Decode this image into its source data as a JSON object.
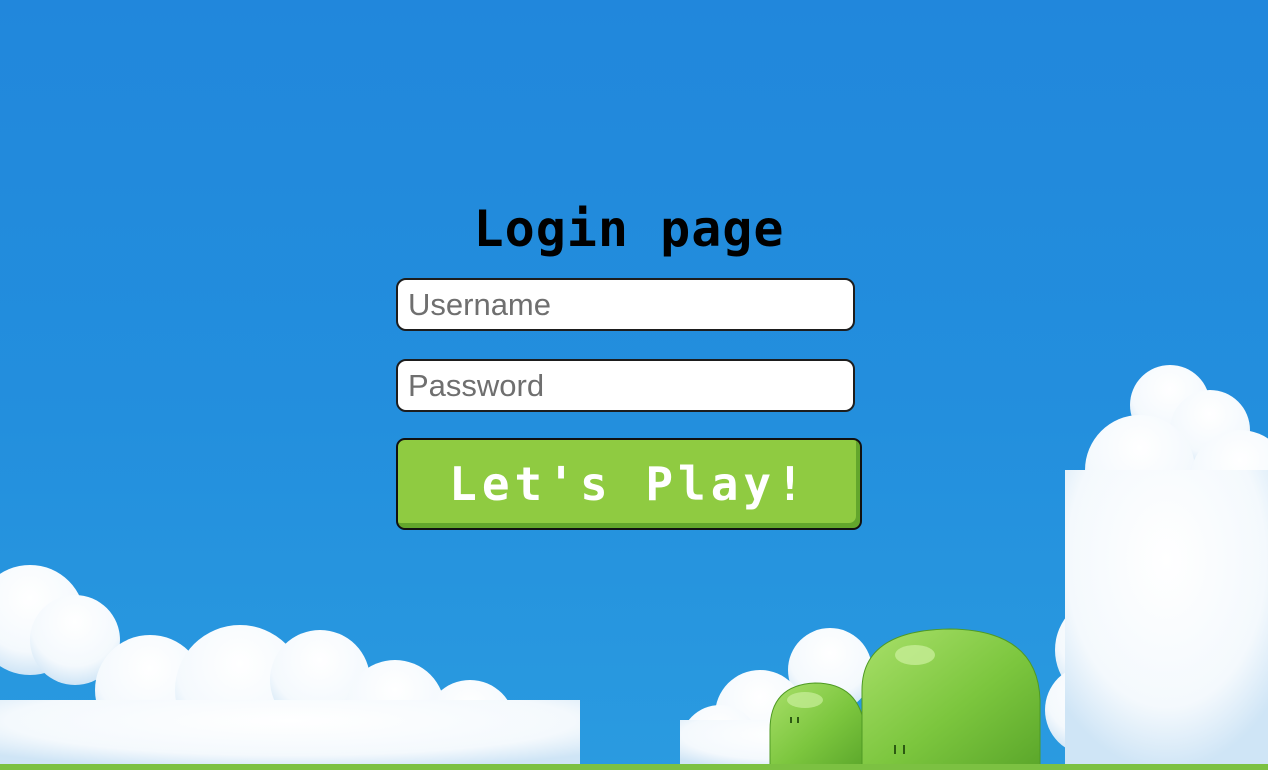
{
  "page": {
    "title": "Login page"
  },
  "form": {
    "username_placeholder": "Username",
    "username_value": "",
    "password_placeholder": "Password",
    "password_value": "",
    "submit_label": "Let's Play!"
  },
  "colors": {
    "sky_top": "#2187dc",
    "sky_bottom": "#2a9be0",
    "button_green": "#8fcb41",
    "button_shade": "#63a62c",
    "hill_green": "#7cc142",
    "cloud_white": "#ffffff"
  },
  "icons": {
    "background": [
      "cloud-icon",
      "green-hill-icon"
    ]
  }
}
